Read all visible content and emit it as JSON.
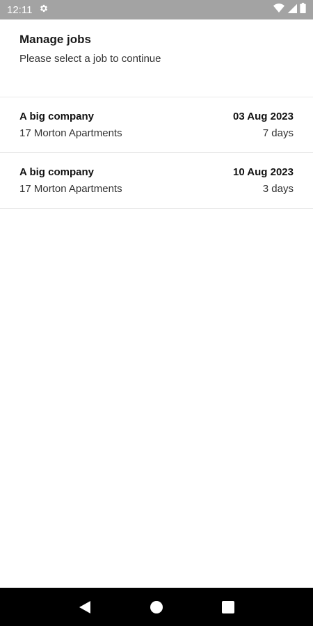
{
  "status_bar": {
    "time": "12:11",
    "icons": [
      "settings-icon",
      "wifi-icon",
      "signal-icon",
      "battery-icon"
    ]
  },
  "header": {
    "title": "Manage jobs",
    "subtitle": "Please select a job to continue"
  },
  "jobs": [
    {
      "company": "A big company",
      "address": "17 Morton Apartments",
      "date": "03 Aug 2023",
      "duration": "7 days"
    },
    {
      "company": "A big company",
      "address": "17 Morton Apartments",
      "date": "10 Aug 2023",
      "duration": "3 days"
    }
  ],
  "nav_bar": {
    "buttons": [
      "back-icon",
      "home-icon",
      "recents-icon"
    ]
  },
  "colors": {
    "status_bar_bg": "#a3a3a3",
    "nav_bar_bg": "#000000",
    "divider": "#e4e4e4"
  }
}
